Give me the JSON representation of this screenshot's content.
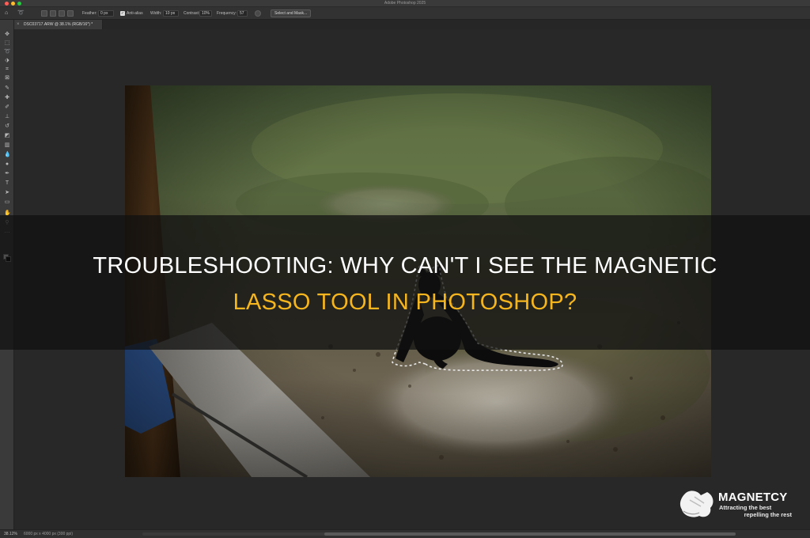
{
  "window": {
    "app_title": "Adobe Photoshop 2025"
  },
  "options_bar": {
    "feather_label": "Feather:",
    "feather_value": "0 px",
    "antialias_label": "Anti-alias",
    "width_label": "Width:",
    "width_value": "10 px",
    "contrast_label": "Contrast:",
    "contrast_value": "10%",
    "frequency_label": "Frequency:",
    "frequency_value": "57",
    "select_mask_label": "Select and Mask..."
  },
  "document": {
    "tab_title": "DSC03717.ARW @ 38.1% (RGB/16*) *"
  },
  "status_bar": {
    "zoom": "38.12%",
    "doc_info": "6000 px x 4000 px (300 ppi)"
  },
  "headline": {
    "line1": "TROUBLESHOOTING: WHY CAN'T I SEE THE MAGNETIC",
    "line2": "LASSO TOOL IN PHOTOSHOP?"
  },
  "logo": {
    "name": "MAGNETCY",
    "tagline1": "Attracting the best",
    "tagline2": "repelling the rest"
  },
  "colors": {
    "headline_accent": "#f5b51e",
    "headline_text": "#ffffff"
  },
  "toolbar": {
    "tools": [
      "move-tool",
      "marquee-tool",
      "lasso-tool",
      "object-select-tool",
      "crop-tool",
      "frame-tool",
      "eyedropper-tool",
      "healing-tool",
      "brush-tool",
      "stamp-tool",
      "history-brush-tool",
      "eraser-tool",
      "gradient-tool",
      "blur-tool",
      "dodge-tool",
      "pen-tool",
      "type-tool",
      "path-select-tool",
      "shape-tool",
      "hand-tool",
      "zoom-tool"
    ]
  }
}
